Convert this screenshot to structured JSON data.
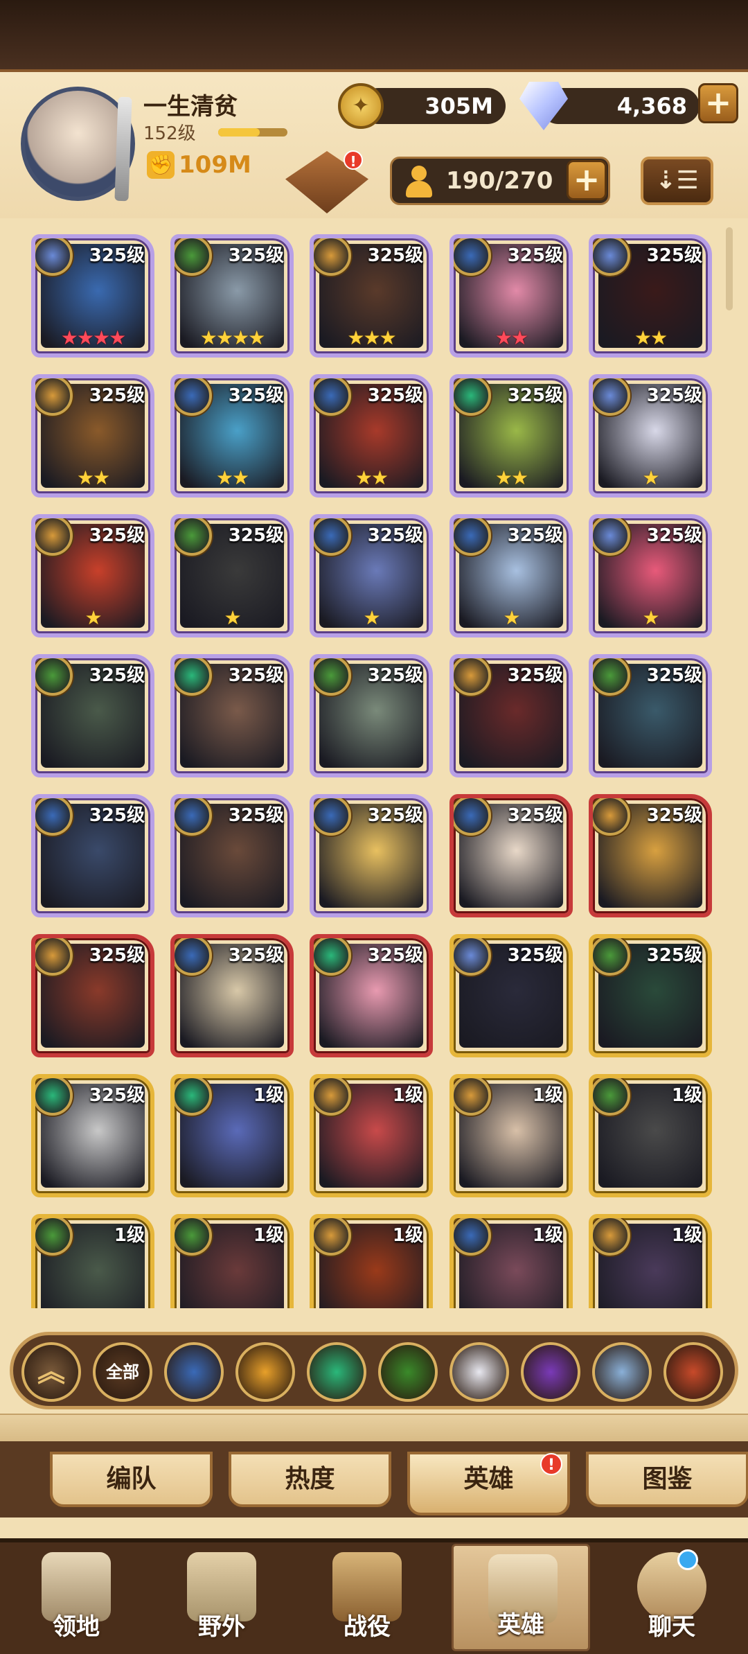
{
  "player": {
    "name": "一生清贫",
    "level": "152级",
    "exp_fraction": 0.6,
    "power": "109M"
  },
  "resources": {
    "gold": "305M",
    "diamonds": "4,368",
    "plus": "+"
  },
  "roster": {
    "capacity": "190/270",
    "sort_icon": "sort-icon"
  },
  "heroes": [
    {
      "level": "325级",
      "stars": "★★★★",
      "star_color": "red",
      "frame": "purple",
      "faction": "celestial",
      "bg": "#3a6ab0"
    },
    {
      "level": "325级",
      "stars": "★★★★",
      "star_color": "gold",
      "frame": "purple",
      "faction": "wilder",
      "bg": "#8a9aa8"
    },
    {
      "level": "325级",
      "stars": "★★★",
      "star_color": "gold",
      "frame": "purple",
      "faction": "graveborn",
      "bg": "#5a3a2a"
    },
    {
      "level": "325级",
      "stars": "★★",
      "star_color": "red",
      "frame": "purple",
      "faction": "lightbearer",
      "bg": "#e28aa8"
    },
    {
      "level": "325级",
      "stars": "★★",
      "star_color": "gold",
      "frame": "purple",
      "faction": "celestial",
      "bg": "#3a1a1a"
    },
    {
      "level": "325级",
      "stars": "★★",
      "star_color": "gold",
      "frame": "purple",
      "faction": "graveborn",
      "bg": "#8a5a2a"
    },
    {
      "level": "325级",
      "stars": "★★",
      "star_color": "gold",
      "frame": "purple",
      "faction": "lightbearer",
      "bg": "#4aa0c8"
    },
    {
      "level": "325级",
      "stars": "★★",
      "star_color": "gold",
      "frame": "purple",
      "faction": "lightbearer",
      "bg": "#a83a2a"
    },
    {
      "level": "325级",
      "stars": "★★",
      "star_color": "gold",
      "frame": "purple",
      "faction": "maulers",
      "bg": "#9ab848"
    },
    {
      "level": "325级",
      "stars": "★",
      "star_color": "gold",
      "frame": "purple",
      "faction": "celestial",
      "bg": "#d8d8e8"
    },
    {
      "level": "325级",
      "stars": "★",
      "star_color": "gold",
      "frame": "purple",
      "faction": "graveborn",
      "bg": "#c8402a"
    },
    {
      "level": "325级",
      "stars": "★",
      "star_color": "gold",
      "frame": "purple",
      "faction": "wilder",
      "bg": "#3a3a3a"
    },
    {
      "level": "325级",
      "stars": "★",
      "star_color": "gold",
      "frame": "purple",
      "faction": "lightbearer",
      "bg": "#6a7ab8"
    },
    {
      "level": "325级",
      "stars": "★",
      "star_color": "gold",
      "frame": "purple",
      "faction": "lightbearer",
      "bg": "#a8c0e0"
    },
    {
      "level": "325级",
      "stars": "★",
      "star_color": "gold",
      "frame": "purple",
      "faction": "celestial",
      "bg": "#e85a7a"
    },
    {
      "level": "325级",
      "stars": "",
      "star_color": "gold",
      "frame": "purple",
      "faction": "wilder",
      "bg": "#4a5a4a"
    },
    {
      "level": "325级",
      "stars": "",
      "star_color": "gold",
      "frame": "purple",
      "faction": "maulers",
      "bg": "#7a5a4a"
    },
    {
      "level": "325级",
      "stars": "",
      "star_color": "gold",
      "frame": "purple",
      "faction": "wilder",
      "bg": "#7a8a7a"
    },
    {
      "level": "325级",
      "stars": "",
      "star_color": "gold",
      "frame": "purple",
      "faction": "graveborn",
      "bg": "#6a2a2a"
    },
    {
      "level": "325级",
      "stars": "",
      "star_color": "gold",
      "frame": "purple",
      "faction": "wilder",
      "bg": "#3a5a6a"
    },
    {
      "level": "325级",
      "stars": "",
      "star_color": "gold",
      "frame": "purple",
      "faction": "lightbearer",
      "bg": "#3a4a6a"
    },
    {
      "level": "325级",
      "stars": "",
      "star_color": "gold",
      "frame": "purple",
      "faction": "lightbearer",
      "bg": "#6a4a3a"
    },
    {
      "level": "325级",
      "stars": "",
      "star_color": "gold",
      "frame": "purple",
      "faction": "lightbearer",
      "bg": "#e8c060"
    },
    {
      "level": "325级",
      "stars": "",
      "star_color": "gold",
      "frame": "red",
      "faction": "lightbearer",
      "bg": "#e8d8c8"
    },
    {
      "level": "325级",
      "stars": "",
      "star_color": "gold",
      "frame": "red",
      "faction": "graveborn",
      "bg": "#d8a040"
    },
    {
      "level": "325级",
      "stars": "",
      "star_color": "gold",
      "frame": "red",
      "faction": "graveborn",
      "bg": "#8a3a2a"
    },
    {
      "level": "325级",
      "stars": "",
      "star_color": "gold",
      "frame": "red",
      "faction": "lightbearer",
      "bg": "#d8c8a8"
    },
    {
      "level": "325级",
      "stars": "",
      "star_color": "gold",
      "frame": "red",
      "faction": "maulers",
      "bg": "#e89ab0"
    },
    {
      "level": "325级",
      "stars": "",
      "star_color": "gold",
      "frame": "gold",
      "faction": "celestial",
      "bg": "#2a2a3a"
    },
    {
      "level": "325级",
      "stars": "",
      "star_color": "gold",
      "frame": "gold",
      "faction": "wilder",
      "bg": "#2a4a3a"
    },
    {
      "level": "325级",
      "stars": "",
      "star_color": "gold",
      "frame": "gold",
      "faction": "maulers",
      "bg": "#c8c8c8"
    },
    {
      "level": "1级",
      "stars": "",
      "star_color": "gold",
      "frame": "gold",
      "faction": "maulers",
      "bg": "#5a6ab8"
    },
    {
      "level": "1级",
      "stars": "",
      "star_color": "gold",
      "frame": "gold",
      "faction": "graveborn",
      "bg": "#c84a4a"
    },
    {
      "level": "1级",
      "stars": "",
      "star_color": "gold",
      "frame": "gold",
      "faction": "graveborn",
      "bg": "#d8c0a8"
    },
    {
      "level": "1级",
      "stars": "",
      "star_color": "gold",
      "frame": "gold",
      "faction": "wilder",
      "bg": "#4a4a4a"
    },
    {
      "level": "1级",
      "stars": "",
      "star_color": "gold",
      "frame": "gold",
      "faction": "wilder",
      "bg": "#4a5a4a"
    },
    {
      "level": "1级",
      "stars": "",
      "star_color": "gold",
      "frame": "gold",
      "faction": "wilder",
      "bg": "#6a3a3a"
    },
    {
      "level": "1级",
      "stars": "",
      "star_color": "gold",
      "frame": "gold",
      "faction": "graveborn",
      "bg": "#9a3a1a"
    },
    {
      "level": "1级",
      "stars": "",
      "star_color": "gold",
      "frame": "gold",
      "faction": "lightbearer",
      "bg": "#7a4a5a"
    },
    {
      "level": "1级",
      "stars": "",
      "star_color": "gold",
      "frame": "gold",
      "faction": "graveborn",
      "bg": "#4a3a5a"
    }
  ],
  "faction_colors": {
    "celestial": "#6a8ad8",
    "wilder": "#4a9a3a",
    "graveborn": "#d89a3a",
    "lightbearer": "#3a6ab8",
    "maulers": "#2ab87a"
  },
  "filters": [
    {
      "name": "collapse-filter",
      "label": "",
      "color": "#7a5a3a"
    },
    {
      "name": "all-filter",
      "label": "全部",
      "color": "#5a3a22"
    },
    {
      "name": "lightbearer-filter",
      "label": "",
      "color": "#3a6ab8"
    },
    {
      "name": "maulers-filter",
      "label": "",
      "color": "#e8a02a"
    },
    {
      "name": "wilder-filter",
      "label": "",
      "color": "#2ab87a"
    },
    {
      "name": "graveborn-filter",
      "label": "",
      "color": "#3a8a2a"
    },
    {
      "name": "celestial-filter",
      "label": "",
      "color": "#e8e8f0"
    },
    {
      "name": "hypogean-filter",
      "label": "",
      "color": "#7a3ab8"
    },
    {
      "name": "dimensional-filter",
      "label": "",
      "color": "#8ab0d8"
    },
    {
      "name": "dragon-filter",
      "label": "",
      "color": "#c84a2a"
    }
  ],
  "tabs": {
    "formation": "编队",
    "popularity": "热度",
    "heroes": "英雄",
    "codex": "图鉴",
    "alert": "!"
  },
  "nav": {
    "territory": "领地",
    "wilderness": "野外",
    "campaign": "战役",
    "heroes": "英雄",
    "chat": "聊天"
  },
  "quest_alert": "!"
}
